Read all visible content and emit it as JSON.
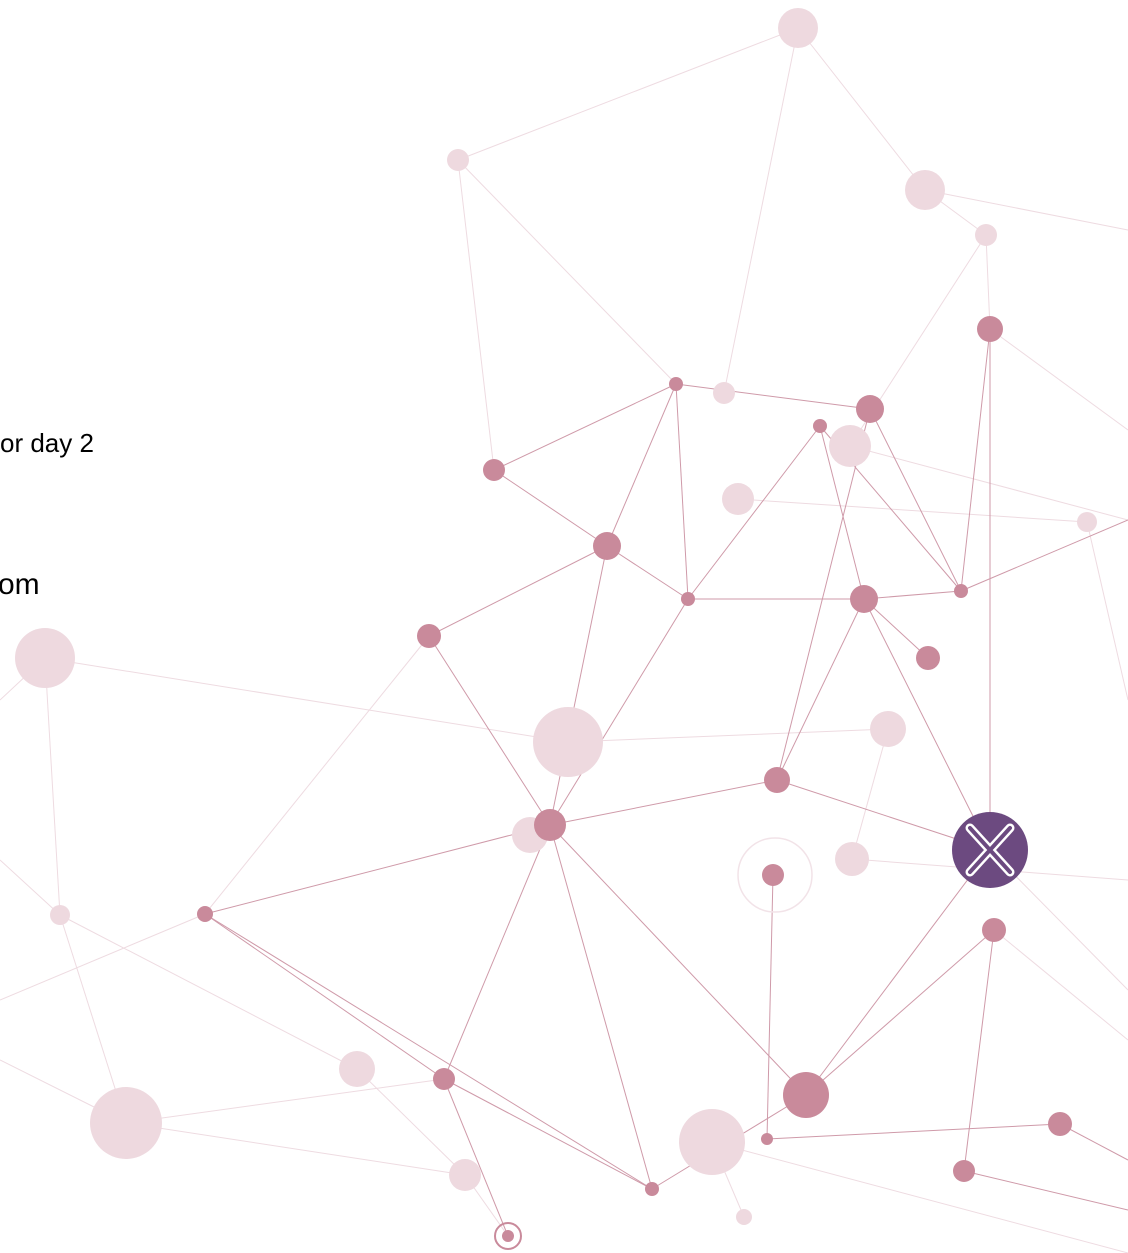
{
  "text_lines": {
    "line_1": "or day 2",
    "line_2": "om"
  },
  "colors": {
    "background": "#ffffff",
    "node_strong": "#c98a9b",
    "node_faint": "#eed9df",
    "edge_strong": "#cf9aa9",
    "edge_faint": "#eedbe1",
    "logo_badge": "#6c4a80"
  },
  "logo": {
    "icon": "x-logo-icon",
    "text": "X"
  }
}
